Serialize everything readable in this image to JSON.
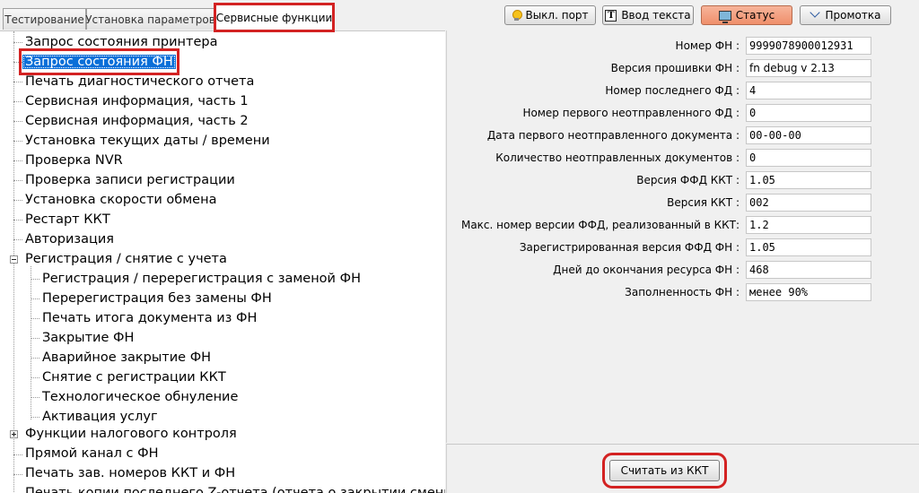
{
  "tabs": [
    {
      "label": "Тестирование"
    },
    {
      "label": "Установка параметров"
    },
    {
      "label": "Сервисные функции"
    }
  ],
  "toolbar": {
    "port_label": "Выкл. порт",
    "text_input_label": "Ввод текста",
    "status_label": "Статус",
    "feed_label": "Промотка"
  },
  "tree": {
    "items": [
      "Запрос состояния принтера",
      "Запрос состояния ФН",
      "Печать диагностического отчета",
      "Сервисная информация, часть 1",
      "Сервисная информация, часть 2",
      "Установка текущих даты / времени",
      "Проверка NVR",
      "Проверка записи регистрации",
      "Установка скорости обмена",
      "Рестарт ККТ",
      "Авторизация",
      "Регистрация / снятие с учета",
      "Регистрация / перерегистрация с заменой ФН",
      "Перерегистрация без замены ФН",
      "Печать итога документа из ФН",
      "Закрытие ФН",
      "Аварийное закрытие ФН",
      "Снятие с регистрации ККТ",
      "Технологическое обнуление",
      "Активация услуг",
      "Функции налогового контроля",
      "Прямой канал с ФН",
      "Печать зав. номеров ККТ и ФН",
      "Печать копии последнего Z-отчета (отчета о закрытии смены)"
    ]
  },
  "fields": [
    {
      "label": "Номер ФН :",
      "value": "9999078900012931"
    },
    {
      "label": "Версия прошивки ФН :",
      "value": "fn debug v 2.13"
    },
    {
      "label": "Номер последнего ФД :",
      "value": "4"
    },
    {
      "label": "Номер первого неотправленного ФД :",
      "value": "0"
    },
    {
      "label": "Дата первого неотправленного документа :",
      "value": "00-00-00"
    },
    {
      "label": "Количество неотправленных документов :",
      "value": "0"
    },
    {
      "label": "Версия ФФД ККТ :",
      "value": "1.05"
    },
    {
      "label": "Версия ККТ :",
      "value": "002"
    },
    {
      "label": "Макс. номер версии ФФД, реализованный в ККТ:",
      "value": "1.2"
    },
    {
      "label": "Зарегистрированная версия ФФД ФН :",
      "value": "1.05"
    },
    {
      "label": "Дней до окончания ресурса ФН :",
      "value": "468"
    },
    {
      "label": "Заполненность ФН :",
      "value": "менее 90%"
    }
  ],
  "actions": {
    "read_label": "Считать из ККТ"
  }
}
